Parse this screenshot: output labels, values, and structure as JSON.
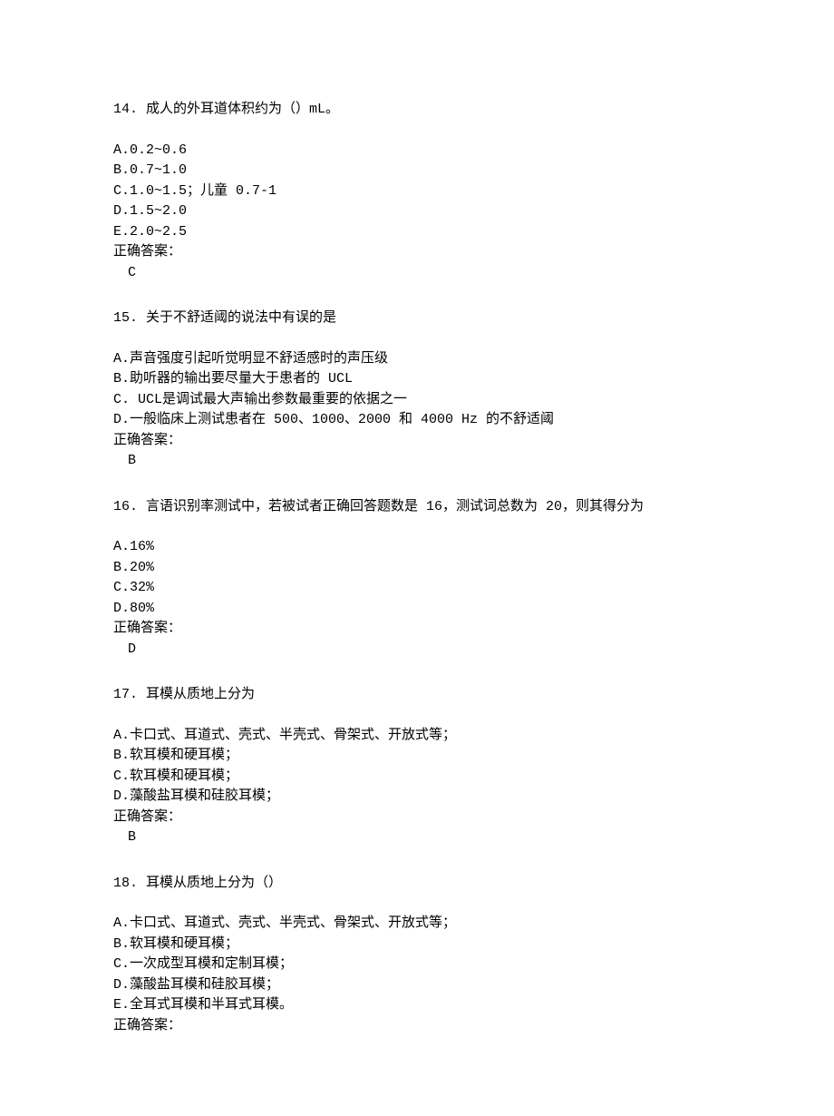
{
  "answer_label": "正确答案：",
  "questions": [
    {
      "number": "14.",
      "text": "成人的外耳道体积约为（）mL。",
      "options": [
        "A.0.2~0.6",
        "B.0.7~1.0",
        "C.1.0~1.5；儿童 0.7-1",
        "D.1.5~2.0",
        "E.2.0~2.5"
      ],
      "answer": "C"
    },
    {
      "number": "15.",
      "text": "关于不舒适阈的说法中有误的是",
      "options": [
        "A.声音强度引起听觉明显不舒适感时的声压级",
        "B.助听器的输出要尽量大于患者的 UCL",
        "C. UCL是调试最大声输出参数最重要的依据之一",
        "D.一般临床上测试患者在 500、1000、2000 和 4000 Hz 的不舒适阈"
      ],
      "answer": "B"
    },
    {
      "number": "16.",
      "text": "言语识别率测试中，若被试者正确回答题数是 16，测试词总数为 20，则其得分为",
      "options": [
        "A.16%",
        "B.20%",
        "C.32%",
        "D.80%"
      ],
      "answer": "D"
    },
    {
      "number": "17.",
      "text": "耳模从质地上分为",
      "options": [
        "A.卡口式、耳道式、壳式、半壳式、骨架式、开放式等；",
        "B.软耳模和硬耳模；",
        "C.软耳模和硬耳模；",
        "D.藻酸盐耳模和硅胶耳模；"
      ],
      "answer": "B"
    },
    {
      "number": "18.",
      "text": "耳模从质地上分为（）",
      "options": [
        "A.卡口式、耳道式、壳式、半壳式、骨架式、开放式等；",
        "B.软耳模和硬耳模；",
        "C.一次成型耳模和定制耳模；",
        "D.藻酸盐耳模和硅胶耳模；",
        "E.全耳式耳模和半耳式耳模。"
      ],
      "answer": ""
    }
  ]
}
